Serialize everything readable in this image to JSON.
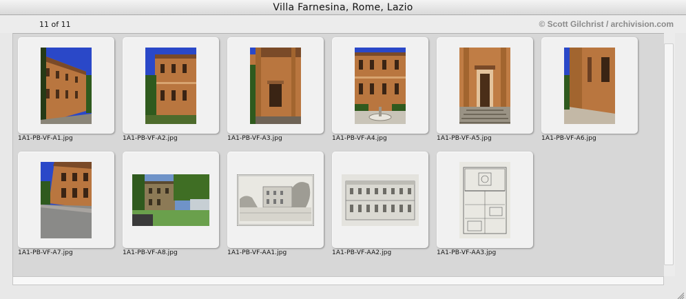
{
  "window": {
    "title": "Villa Farnesina, Rome, Lazio"
  },
  "info": {
    "count": "11 of 11",
    "credit": "© Scott Gilchrist / archivision.com"
  },
  "thumbnails": [
    {
      "filename": "1A1-PB-VF-A1.jpg",
      "kind": "photo-facade-perspective"
    },
    {
      "filename": "1A1-PB-VF-A2.jpg",
      "kind": "photo-facade-front"
    },
    {
      "filename": "1A1-PB-VF-A3.jpg",
      "kind": "photo-facade-corner"
    },
    {
      "filename": "1A1-PB-VF-A4.jpg",
      "kind": "photo-facade-fountain"
    },
    {
      "filename": "1A1-PB-VF-A5.jpg",
      "kind": "photo-doorway"
    },
    {
      "filename": "1A1-PB-VF-A6.jpg",
      "kind": "photo-wall-angle"
    },
    {
      "filename": "1A1-PB-VF-A7.jpg",
      "kind": "photo-wall-perspective"
    },
    {
      "filename": "1A1-PB-VF-A8.jpg",
      "kind": "photo-garden"
    },
    {
      "filename": "1A1-PB-VF-AA1.jpg",
      "kind": "engraving-view"
    },
    {
      "filename": "1A1-PB-VF-AA2.jpg",
      "kind": "drawing-elevation"
    },
    {
      "filename": "1A1-PB-VF-AA3.jpg",
      "kind": "drawing-plan"
    }
  ],
  "colors": {
    "sky": "#2a48c8",
    "facade": "#b9763f",
    "facade_dark": "#7a4a28",
    "foliage": "#2f5a1e",
    "paper": "#e9e8e2",
    "ink": "#555555"
  }
}
